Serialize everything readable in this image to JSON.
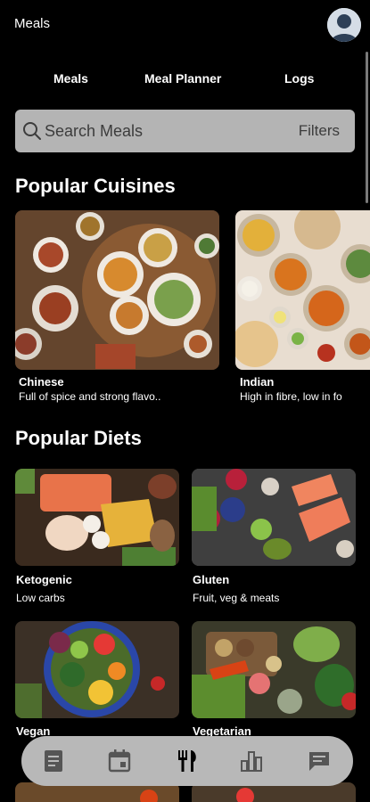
{
  "header": {
    "title": "Meals"
  },
  "tabs": [
    {
      "label": "Meals"
    },
    {
      "label": "Meal Planner"
    },
    {
      "label": "Logs"
    }
  ],
  "search": {
    "placeholder": "Search Meals",
    "filters_label": "Filters"
  },
  "sections": {
    "cuisines_title": "Popular Cuisines",
    "diets_title": "Popular Diets"
  },
  "cuisines": [
    {
      "name": "Chinese",
      "description": "Full of spice and strong flavo.."
    },
    {
      "name": "Indian",
      "description": "High in fibre, low in fo"
    }
  ],
  "diets": [
    {
      "name": "Ketogenic",
      "description": "Low carbs"
    },
    {
      "name": "Gluten",
      "description": "Fruit, veg & meats"
    },
    {
      "name": "Vegan",
      "description": ""
    },
    {
      "name": "Vegetarian",
      "description": ""
    }
  ],
  "bottom_nav": [
    {
      "icon": "document-icon"
    },
    {
      "icon": "calendar-icon"
    },
    {
      "icon": "fork-knife-icon"
    },
    {
      "icon": "bar-chart-icon"
    },
    {
      "icon": "chat-icon"
    }
  ],
  "colors": {
    "background": "#000000",
    "search_bg": "#b4b4b4",
    "nav_bg": "#b8b8b8"
  }
}
